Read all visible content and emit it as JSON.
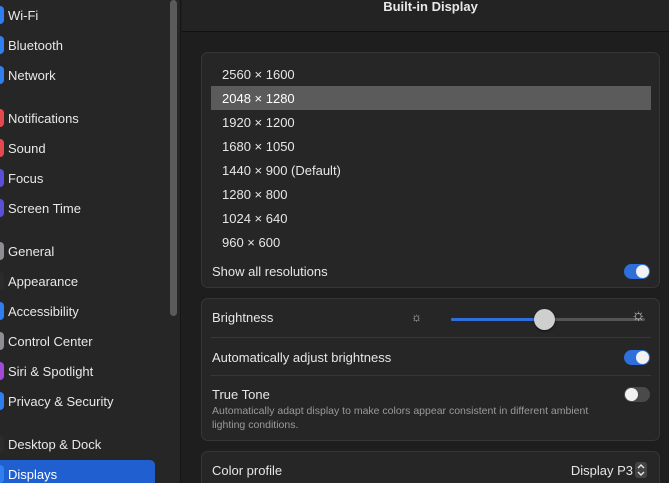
{
  "sidebar": {
    "items": [
      {
        "label": "Wi-Fi",
        "icon": "wifi-icon",
        "color": "#2f7ff0"
      },
      {
        "label": "Bluetooth",
        "icon": "bluetooth-icon",
        "color": "#2f7ff0"
      },
      {
        "label": "Network",
        "icon": "network-icon",
        "color": "#2f7ff0"
      },
      {
        "label": "Notifications",
        "icon": "notifications-icon",
        "color": "#e5484d"
      },
      {
        "label": "Sound",
        "icon": "sound-icon",
        "color": "#e5484d"
      },
      {
        "label": "Focus",
        "icon": "focus-icon",
        "color": "#5b4fd6"
      },
      {
        "label": "Screen Time",
        "icon": "screen-time-icon",
        "color": "#5b4fd6"
      },
      {
        "label": "General",
        "icon": "general-icon",
        "color": "#8e8e93"
      },
      {
        "label": "Appearance",
        "icon": "appearance-icon",
        "color": "#2b2b2b"
      },
      {
        "label": "Accessibility",
        "icon": "accessibility-icon",
        "color": "#2f7ff0"
      },
      {
        "label": "Control Center",
        "icon": "control-center-icon",
        "color": "#8e8e93"
      },
      {
        "label": "Siri & Spotlight",
        "icon": "siri-icon",
        "color": "#a04bd8"
      },
      {
        "label": "Privacy & Security",
        "icon": "privacy-icon",
        "color": "#2f7ff0"
      },
      {
        "label": "Desktop & Dock",
        "icon": "desktop-dock-icon",
        "color": "#2b2b2b"
      },
      {
        "label": "Displays",
        "icon": "displays-icon",
        "color": "#2f7ff0",
        "active": true
      }
    ]
  },
  "header": {
    "title": "Built-in Display"
  },
  "resolutions": {
    "options": [
      "2560 × 1600",
      "2048 × 1280",
      "1920 × 1200",
      "1680 × 1050",
      "1440 × 900 (Default)",
      "1280 × 800",
      "1024 × 640",
      "960 × 600"
    ],
    "selected_index": 1,
    "show_all_label": "Show all resolutions",
    "show_all_on": true
  },
  "brightness": {
    "label": "Brightness",
    "level": 0.48,
    "auto_label": "Automatically adjust brightness",
    "auto_on": true,
    "true_tone_label": "True Tone",
    "true_tone_desc": "Automatically adapt display to make colors appear consistent in different ambient lighting conditions.",
    "true_tone_on": false
  },
  "color_profile": {
    "label": "Color profile",
    "value": "Display P3"
  },
  "colors": {
    "accent": "#2f6fdb",
    "selection": "#1f5fcf"
  }
}
